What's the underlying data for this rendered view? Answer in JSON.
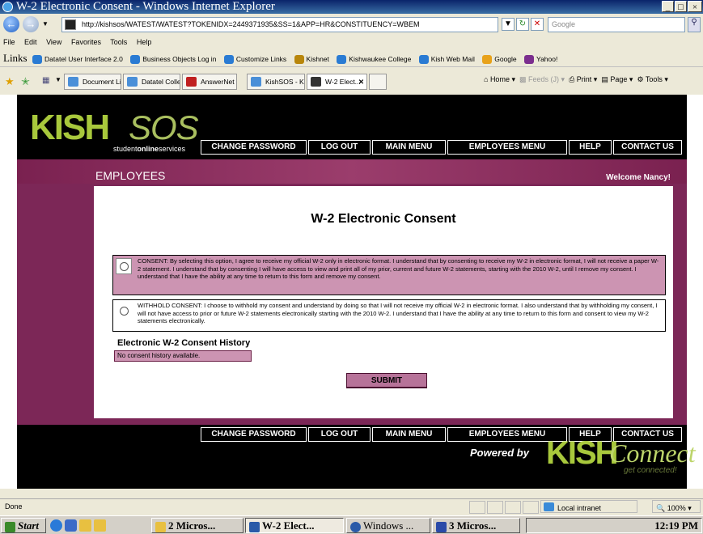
{
  "window": {
    "title": "W-2 Electronic Consent - Windows Internet Explorer",
    "controls": [
      "_",
      "□",
      "×"
    ]
  },
  "address_bar": {
    "url": "http://kishsos/WATEST/WATEST?TOKENIDX=2449371935&SS=1&APP=HR&CONSTITUENCY=WBEM",
    "search_placeholder": "Google"
  },
  "menu": [
    "File",
    "Edit",
    "View",
    "Favorites",
    "Tools",
    "Help"
  ],
  "links_bar": {
    "label": "Links",
    "items": [
      "Datatel User Interface 2.0",
      "Business Objects Log in",
      "Customize Links",
      "Kishnet",
      "Kishwaukee College",
      "Kish Web Mail",
      "Google",
      "Yahoo!"
    ]
  },
  "tabs": [
    {
      "label": "Document Lib..."
    },
    {
      "label": "Datatel Collea..."
    },
    {
      "label": "AnswerNet"
    },
    {
      "label": "KishSOS - Kis..."
    },
    {
      "label": "W-2 Elect..."
    }
  ],
  "tab_tools": {
    "home": "Home",
    "feeds": "Feeds (J)",
    "print": "Print",
    "page": "Page",
    "tools": "Tools"
  },
  "site": {
    "logo_kish": "KISH",
    "logo_sos": "SOS",
    "logo_tagline_prefix": "student",
    "logo_tagline_bold": "online",
    "logo_tagline_suffix": "services",
    "nav": {
      "change_password": "Change Password",
      "log_out": "Log Out",
      "main_menu": "Main Menu",
      "employees_menu": "Employees Menu",
      "help": "Help",
      "contact_us": "Contact Us"
    },
    "section": "EMPLOYEES",
    "welcome": "Welcome Nancy!",
    "page_title": "W-2 Electronic Consent",
    "consent_text": "CONSENT: By selecting this option, I agree to receive my official W-2 only in electronic format. I understand that by consenting to receive my W-2 in electronic format, I will not receive a paper W-2 statement. I understand that by consenting I will have access to view and print all of my prior, current and future W-2 statements, starting with the 2010 W-2, until I remove my consent. I understand that I have the ability at any time to return to this form and remove my consent.",
    "withhold_text": "WITHHOLD CONSENT: I choose to withhold my consent and understand by doing so that I will not receive my official W-2 in electronic format. I also understand that by withholding my consent, I will not have access to prior or future W-2 statements electronically starting with the 2010 W-2. I understand that I have the ability at any time to return to this form and consent to view my W-2 statements electronically.",
    "history_title": "Electronic W-2 Consent History",
    "history_empty": "No consent history available.",
    "submit": "SUBMIT",
    "powered_by": "Powered by",
    "footer_logo_kish": "KISH",
    "footer_logo_connect": "Connect",
    "footer_logo_tagline": "get connected!"
  },
  "status_bar": {
    "text": "Done",
    "zone": "Local intranet",
    "zoom": "100%"
  },
  "taskbar": {
    "start": "Start",
    "items": [
      "2 Micros...",
      "W-2 Elect...",
      "Windows ...",
      "3 Micros..."
    ],
    "clock": "12:19 PM"
  }
}
